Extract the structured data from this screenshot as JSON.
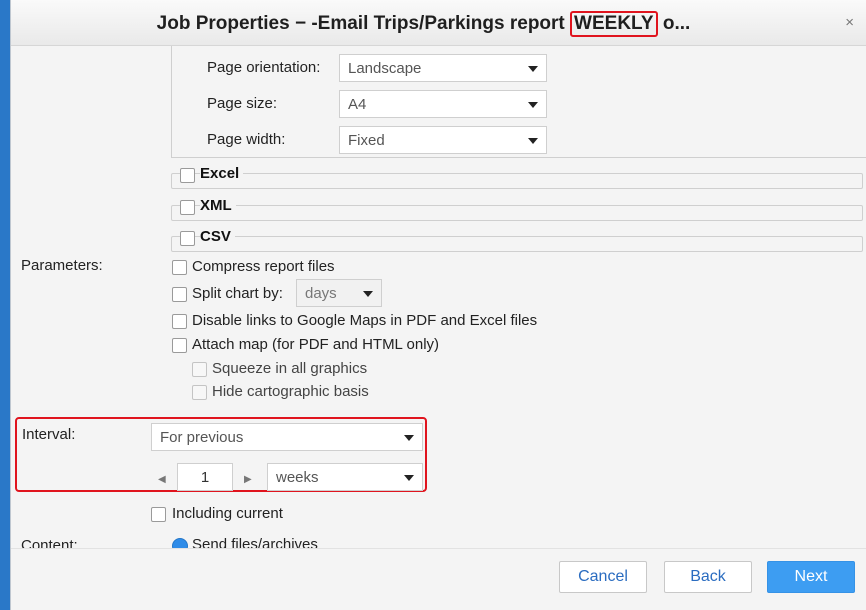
{
  "dialog": {
    "title_prefix": "Job Properties − -Email Trips/Parkings report ",
    "title_highlight": "WEEKLY",
    "title_suffix": " o...",
    "close": "×"
  },
  "pdf_options": {
    "orientation_label": "Page orientation:",
    "orientation_value": "Landscape",
    "size_label": "Page size:",
    "size_value": "A4",
    "width_label": "Page width:",
    "width_value": "Fixed"
  },
  "sections": {
    "excel": "Excel",
    "xml": "XML",
    "csv": "CSV"
  },
  "parameters": {
    "label": "Parameters:",
    "compress": "Compress report files",
    "split_chart": "Split chart by:",
    "split_value": "days",
    "disable_links": "Disable links to Google Maps in PDF and Excel files",
    "attach_map": "Attach map (for PDF and HTML only)",
    "squeeze": "Squeeze in all graphics",
    "hide_basis": "Hide cartographic basis"
  },
  "interval": {
    "label": "Interval:",
    "mode": "For previous",
    "count": "1",
    "unit": "weeks",
    "including_current": "Including current"
  },
  "content": {
    "label": "Content:",
    "send_files": "Send files/archives"
  },
  "footer": {
    "cancel": "Cancel",
    "back": "Back",
    "next": "Next"
  }
}
